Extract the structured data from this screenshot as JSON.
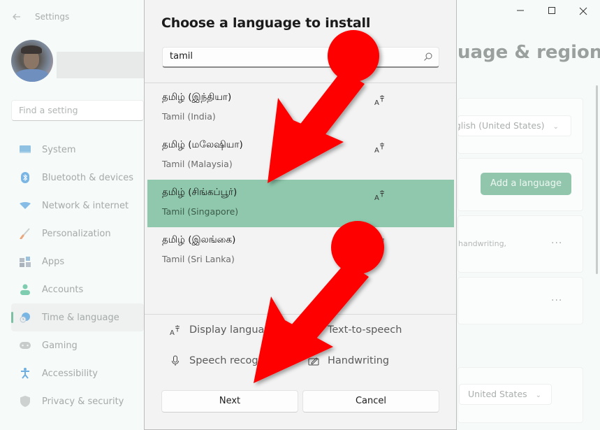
{
  "window": {
    "title": "Settings",
    "controls": {
      "minimize": "—",
      "maximize": "☐",
      "close": "✕"
    }
  },
  "sidebar": {
    "search_placeholder": "Find a setting",
    "items": [
      {
        "label": "System",
        "icon": "monitor-icon",
        "color": "#7fb7dd"
      },
      {
        "label": "Bluetooth & devices",
        "icon": "bluetooth-icon",
        "color": "#5aa6e0"
      },
      {
        "label": "Network & internet",
        "icon": "wifi-icon",
        "color": "#6aa9de"
      },
      {
        "label": "Personalization",
        "icon": "brush-icon",
        "color": "#e39a6c"
      },
      {
        "label": "Apps",
        "icon": "apps-icon",
        "color": "#98a6b5"
      },
      {
        "label": "Accounts",
        "icon": "person-icon",
        "color": "#6cc3a2"
      },
      {
        "label": "Time & language",
        "icon": "globe-clock-icon",
        "color": "#5fa4d8",
        "active": true
      },
      {
        "label": "Gaming",
        "icon": "gamepad-icon",
        "color": "#b0b6b4"
      },
      {
        "label": "Accessibility",
        "icon": "accessibility-icon",
        "color": "#4d9ad6"
      },
      {
        "label": "Privacy & security",
        "icon": "shield-icon",
        "color": "#a6adab"
      }
    ]
  },
  "main": {
    "page_title": "uage & region",
    "windows_display_language": "English (United States)",
    "add_language_label": "Add a language",
    "language_card_subtext": ", handwriting,",
    "more_label": "···",
    "country_region": "United States",
    "accent_color": "#91c6ad"
  },
  "dialog": {
    "title": "Choose a language to install",
    "search_value": "tamil",
    "search_icon": "search-icon",
    "languages": [
      {
        "native": "தமிழ் (இந்தியா)",
        "english": "Tamil (India)",
        "feature_icon": "display-language-icon",
        "selected": false
      },
      {
        "native": "தமிழ் (மலேஷியா)",
        "english": "Tamil (Malaysia)",
        "feature_icon": "display-language-icon",
        "selected": false
      },
      {
        "native": "தமிழ் (சிங்கப்பூர்)",
        "english": "Tamil (Singapore)",
        "feature_icon": "display-language-icon",
        "selected": true
      },
      {
        "native": "தமிழ் (இலங்கை)",
        "english": "Tamil (Sri Lanka)",
        "feature_icon": "display-language-icon",
        "selected": false
      }
    ],
    "features": [
      {
        "label": "Display language",
        "icon": "display-language-icon"
      },
      {
        "label": "Text-to-speech",
        "icon": "text-to-speech-icon"
      },
      {
        "label": "Speech recognition",
        "icon": "microphone-icon"
      },
      {
        "label": "Handwriting",
        "icon": "handwriting-icon"
      }
    ],
    "buttons": {
      "next": "Next",
      "cancel": "Cancel"
    },
    "selected_color": "#8fc8ac"
  },
  "annotations": {
    "arrow_color": "#ff0000",
    "arrows": [
      {
        "points_to": "Tamil (Singapore) list item"
      },
      {
        "points_to": "Next button"
      }
    ]
  }
}
